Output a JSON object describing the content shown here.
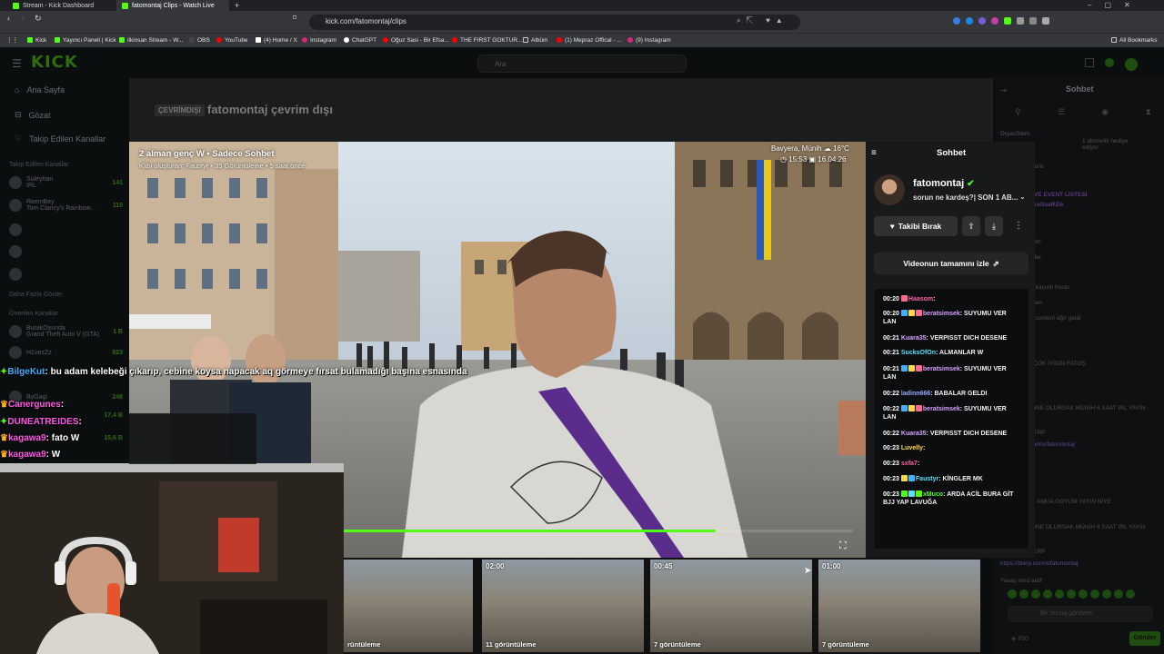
{
  "browser": {
    "tabs": [
      {
        "label": "Stream - Kick Dashboard",
        "active": false
      },
      {
        "label": "fatomontaj Clips - Watch Live",
        "active": true
      }
    ],
    "new_tab": "+",
    "url": "kick.com/fatomontaj/clips",
    "bookmarks": [
      "Kick",
      "Yayıncı Paneli | Kick",
      "ilkinsan Stream - W...",
      "OBS",
      "YouTube",
      "(4) Home / X",
      "Instagram",
      "ChatGPT",
      "Oğuz Sasi - Bir Efsa...",
      "THE FIRST GOKTUR...",
      "Albüm",
      "(1) Mepraz Offical - ...",
      "(9) Instagram"
    ],
    "all_bookmarks": "All Bookmarks"
  },
  "kick": {
    "logo": "KICK",
    "search_placeholder": "Ara",
    "nav": [
      {
        "label": "Ana Sayfa",
        "icon": "home-icon"
      },
      {
        "label": "Gözat",
        "icon": "browse-icon"
      },
      {
        "label": "Takip Edilen Kanallar",
        "icon": "heart-icon"
      }
    ],
    "followed_heading": "Takip Edilen Kanallar",
    "followed": [
      {
        "name": "Suleyhan",
        "game": "IRL",
        "count": "141"
      },
      {
        "name": "ReemBey",
        "game": "Tom Clancy's Rainbow...",
        "count": "115"
      }
    ],
    "show_more": "Daha Fazla Göster",
    "recommended_heading": "Önerilen Kanallar",
    "recommended": [
      {
        "name": "BurakOyunda",
        "game": "Grand Theft Auto V (GTA)",
        "count": "1 B"
      },
      {
        "name": "H1vezZz",
        "game": "",
        "count": "923"
      },
      {
        "name": "ByGagi",
        "game": "",
        "count": "248"
      },
      {
        "name": "",
        "game": "",
        "count": "17,4 B"
      },
      {
        "name": "",
        "game": "",
        "count": "15,6 B"
      }
    ],
    "offline_badge": "ÇEVRİMDIŞI",
    "offline_title": "fatomontaj çevrim dışı",
    "right_chat_title": "Sohbet",
    "right_chat_lines": [
      "DryasStern",
      "1 abonelik hediye ediyor",
      "fatomontaj: bura",
      "KİŞİ SAYISI VE EVENT LİSTESİ",
      "ernt.sc/4CzwaGsaRZik",
      "28: HAY",
      "montaj: söylelin",
      "montaj: o kadar",
      "florit: niye",
      "beratsimsek: kaçırdı hostu",
      "florit: kapadı lan",
      "beratsimsek: content ağır geldi",
      "beratsimsek:",
      "28:",
      "28: BUGÜN ÇOK İYİDİN FATOŞ",
      "Faustyr:",
      "Rifle: 50 ABONE OLURSAK MÜNİH 4 SAAT IRL YAYIN BLERPLİ",
      "Aksiyon: IBLERP",
      "ttps://blerp.com/x/fatomontaj",
      "montaj:",
      "AMUA GOYUM YAYIN NİYE",
      "Rifle: 50 ABONE OLURSAK MÜNİH 4 SAAT IRL YAYIN BLERPLİ",
      "Aksiyon: IBLERP",
      "https://blerp.com/x/fatomontaj",
      "Yavaş mod aktif"
    ],
    "chat_input_placeholder": "Bir mesaj gönderin",
    "points": "890",
    "send_label": "Gönder"
  },
  "clip": {
    "title": "2 alman genç W • Sadece Sohbet",
    "meta": "Klibi oluşturan: Faustyr • 35 Görüntüleme • 5 saat önce",
    "weather_loc": "Bavyera, Münih",
    "weather_temp": "16°C",
    "time1": "15:53",
    "time2": "16.04.26",
    "progress": 0.73
  },
  "panel": {
    "title": "Sohbet",
    "channel": "fatomontaj",
    "stream_title": "sorun ne kardeş?| SON 1 AB...",
    "follow_label": "Takibi Bırak",
    "watch_full_label": "Videonun tamamını izle",
    "messages": [
      {
        "time": "00:20",
        "user": "Haasom",
        "text": ":",
        "color": "u1",
        "badges": [
          "#ff6b8a"
        ]
      },
      {
        "time": "00:20",
        "user": "beratsimsek",
        "text": ": SUYUMU VER LAN",
        "color": "u2",
        "badges": [
          "#3fb1ff",
          "#ffd84d",
          "#ff6b8a"
        ]
      },
      {
        "time": "00:21",
        "user": "Kuara35",
        "text": ": VERPISST DICH DESENE",
        "color": "u2",
        "badges": []
      },
      {
        "time": "00:21",
        "user": "SucksOfOn",
        "text": ": ALMANLAR W",
        "color": "u3",
        "badges": []
      },
      {
        "time": "00:21",
        "user": "beratsimsek",
        "text": ": SUYUMU VER LAN",
        "color": "u2",
        "badges": [
          "#3fb1ff",
          "#ffd84d",
          "#ff6b8a"
        ]
      },
      {
        "time": "00:22",
        "user": "ladinn666",
        "text": ": BABALAR GELDI",
        "color": "u6",
        "badges": []
      },
      {
        "time": "00:22",
        "user": "beratsimsek",
        "text": ": SUYUMU VER LAN",
        "color": "u2",
        "badges": [
          "#3fb1ff",
          "#ffd84d",
          "#ff6b8a"
        ]
      },
      {
        "time": "00:22",
        "user": "Kuara35",
        "text": ": VERPISST DICH DESENE",
        "color": "u2",
        "badges": []
      },
      {
        "time": "00:23",
        "user": "Luvelly",
        "text": ":",
        "color": "u5",
        "badges": []
      },
      {
        "time": "00:23",
        "user": "sxfa7",
        "text": ":",
        "color": "u1",
        "badges": []
      },
      {
        "time": "00:23",
        "user": "Faustyr",
        "text": ": KİNGLER MK",
        "color": "u3",
        "badges": [
          "#ffd84d",
          "#3fb1ff"
        ]
      },
      {
        "time": "00:23",
        "user": "xMuco",
        "text": ": ARDA ACİL BURA GİT BJJ YAP LAVUĞA",
        "color": "u4",
        "badges": [
          "#53fc18",
          "#58e0ff",
          "#53fc18"
        ]
      }
    ]
  },
  "thumbs": [
    {
      "duration": "",
      "views": "rüntüleme"
    },
    {
      "duration": "02:00",
      "views": "11 görüntüleme"
    },
    {
      "duration": "00:45",
      "views": "7 görüntüleme"
    },
    {
      "duration": "01:00",
      "views": "7 görüntüleme"
    }
  ],
  "overlay_chat": [
    {
      "user": "BilgeKut",
      "text": ": bu adam kelebeği çıkarıp, cebine koysa napacak aq görmeye fırsat bulamadığı başına esnasında",
      "nameclass": "nm2"
    },
    {
      "user": "Canergunes",
      "text": ":",
      "nameclass": "nm"
    },
    {
      "user": "DUNEATREIDES",
      "text": ":",
      "nameclass": "nm"
    },
    {
      "user": "kagawa9",
      "text": ": fato W",
      "nameclass": "nm"
    },
    {
      "user": "kagawa9",
      "text": ": W",
      "nameclass": "nm"
    }
  ],
  "colors": {
    "brand": "#53fc18",
    "accent_purple": "#7b3fbf"
  }
}
